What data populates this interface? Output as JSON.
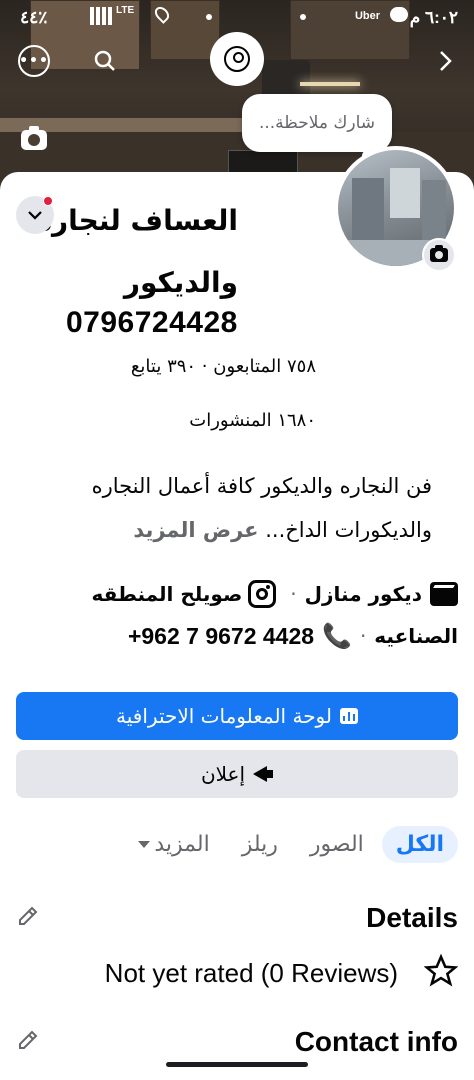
{
  "status_bar": {
    "time": "٦:٠٢ م",
    "carrier": "Uber",
    "battery": "٪٤٤",
    "network": "LTE"
  },
  "top_nav": {
    "more_label": "•••"
  },
  "note": {
    "placeholder": "شارك ملاحظة..."
  },
  "profile": {
    "name": "العساف لنجاره والديكور",
    "phone_title": "0796724428",
    "followers_line": "٧٥٨ المتابعون · ٣٩٠ يتابع",
    "posts_line": "١٦٨٠ المنشورات",
    "bio": "فن النجاره والديكور  كافة أعمال النجاره والديكورات الداخ...",
    "see_more": "عرض المزيد"
  },
  "info": {
    "category": "ديكور منازل",
    "location": "صويلح المنطقه الصناعيه",
    "phone": "+962 7 9672 4428"
  },
  "buttons": {
    "dashboard": "لوحة المعلومات الاحترافية",
    "ad": "إعلان"
  },
  "tabs": [
    {
      "label": "الكل"
    },
    {
      "label": "الصور"
    },
    {
      "label": "ريلز"
    },
    {
      "label": "المزيد"
    }
  ],
  "details": {
    "title": "Details",
    "rating": "Not yet rated (0 Reviews)",
    "contact_title": "Contact info"
  },
  "colors": {
    "accent": "#1877f2",
    "secondary_button": "#e4e6eb",
    "badge": "#e41e3f"
  }
}
